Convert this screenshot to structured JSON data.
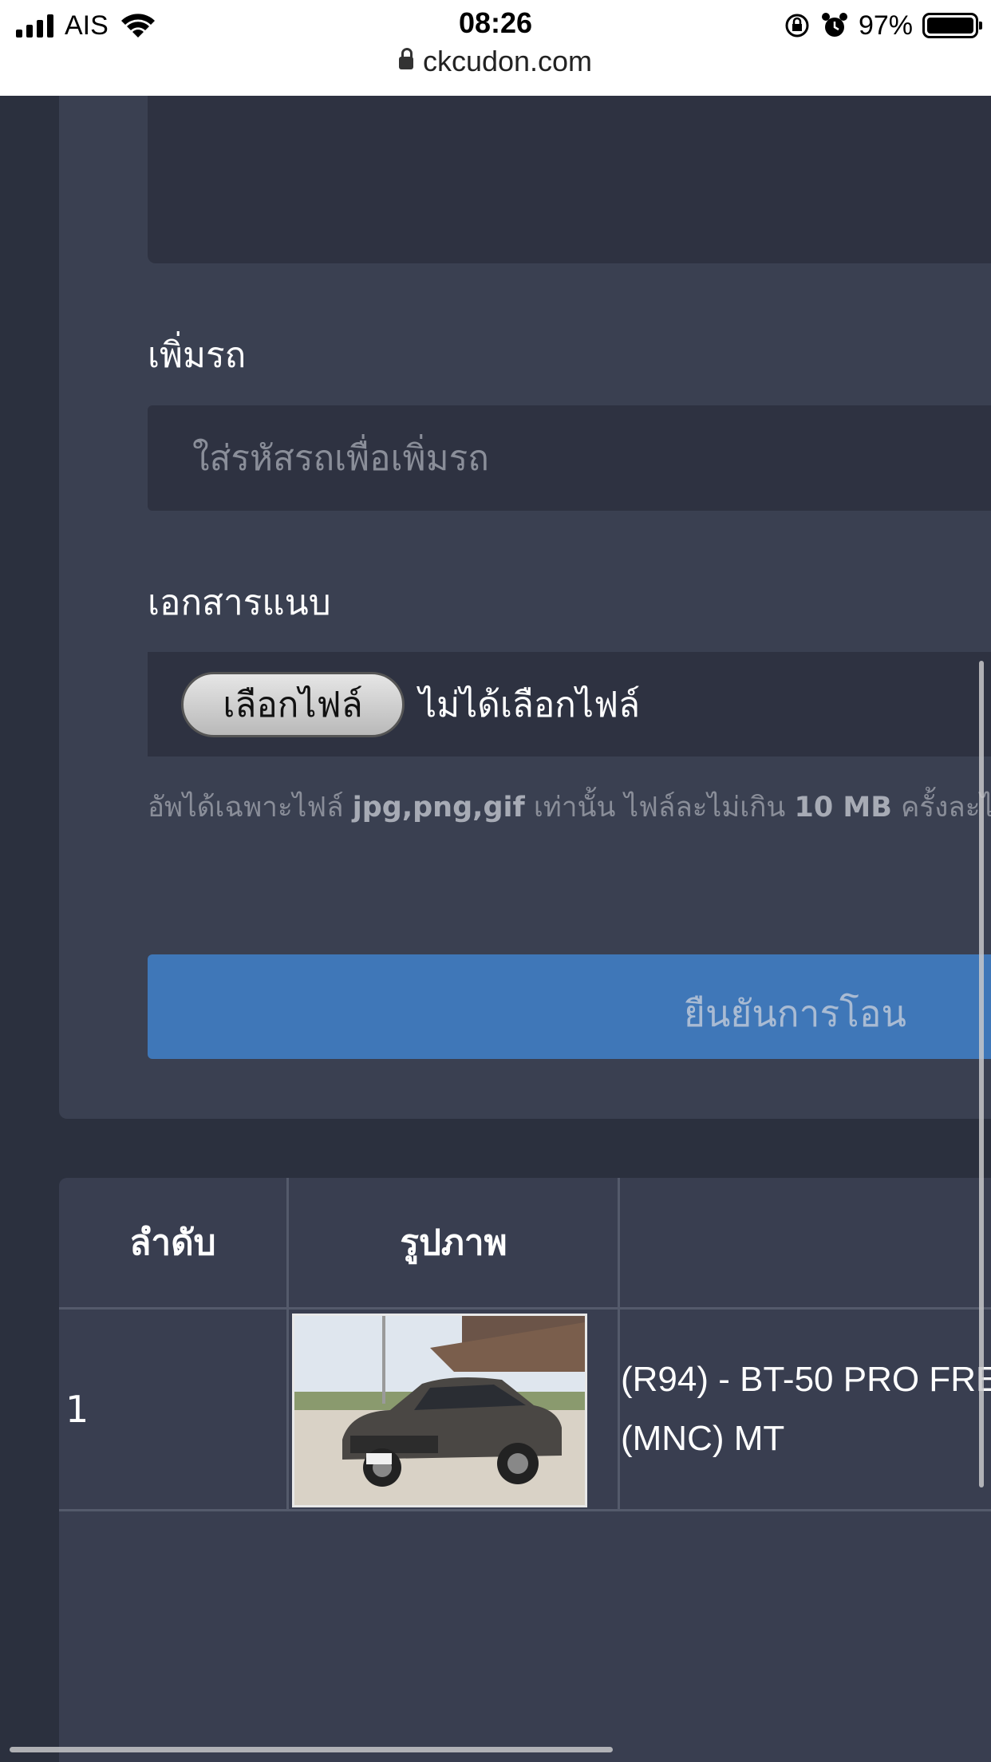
{
  "status_bar": {
    "carrier": "AIS",
    "time": "08:26",
    "battery": "97%",
    "url": "ckcudon.com"
  },
  "form": {
    "add_car_label": "เพิ่มรถ",
    "add_car_placeholder": "ใส่รหัสรถเพื่อเพิ่มรถ",
    "attachment_label": "เอกสารแนบ",
    "choose_file_label": "เลือกไฟล์",
    "no_file_label": "ไม่ได้เลือกไฟล์",
    "hint": {
      "prefix": "อัพได้เฉพาะไฟล์ ",
      "types": "jpg,png,gif",
      "middle": " เท่านั้น ไฟล์ละไม่เกิน ",
      "size": "10 MB",
      "suffix": " ครั้งละไม่เกิ"
    },
    "confirm_label": "ยืนยันการโอน"
  },
  "table": {
    "headers": [
      "ลำดับ",
      "รูปภาพ",
      ""
    ],
    "rows": [
      {
        "index": "1",
        "name_line1": "(R94) - BT-50 PRO FRE",
        "name_line2": "(MNC) MT"
      }
    ]
  }
}
